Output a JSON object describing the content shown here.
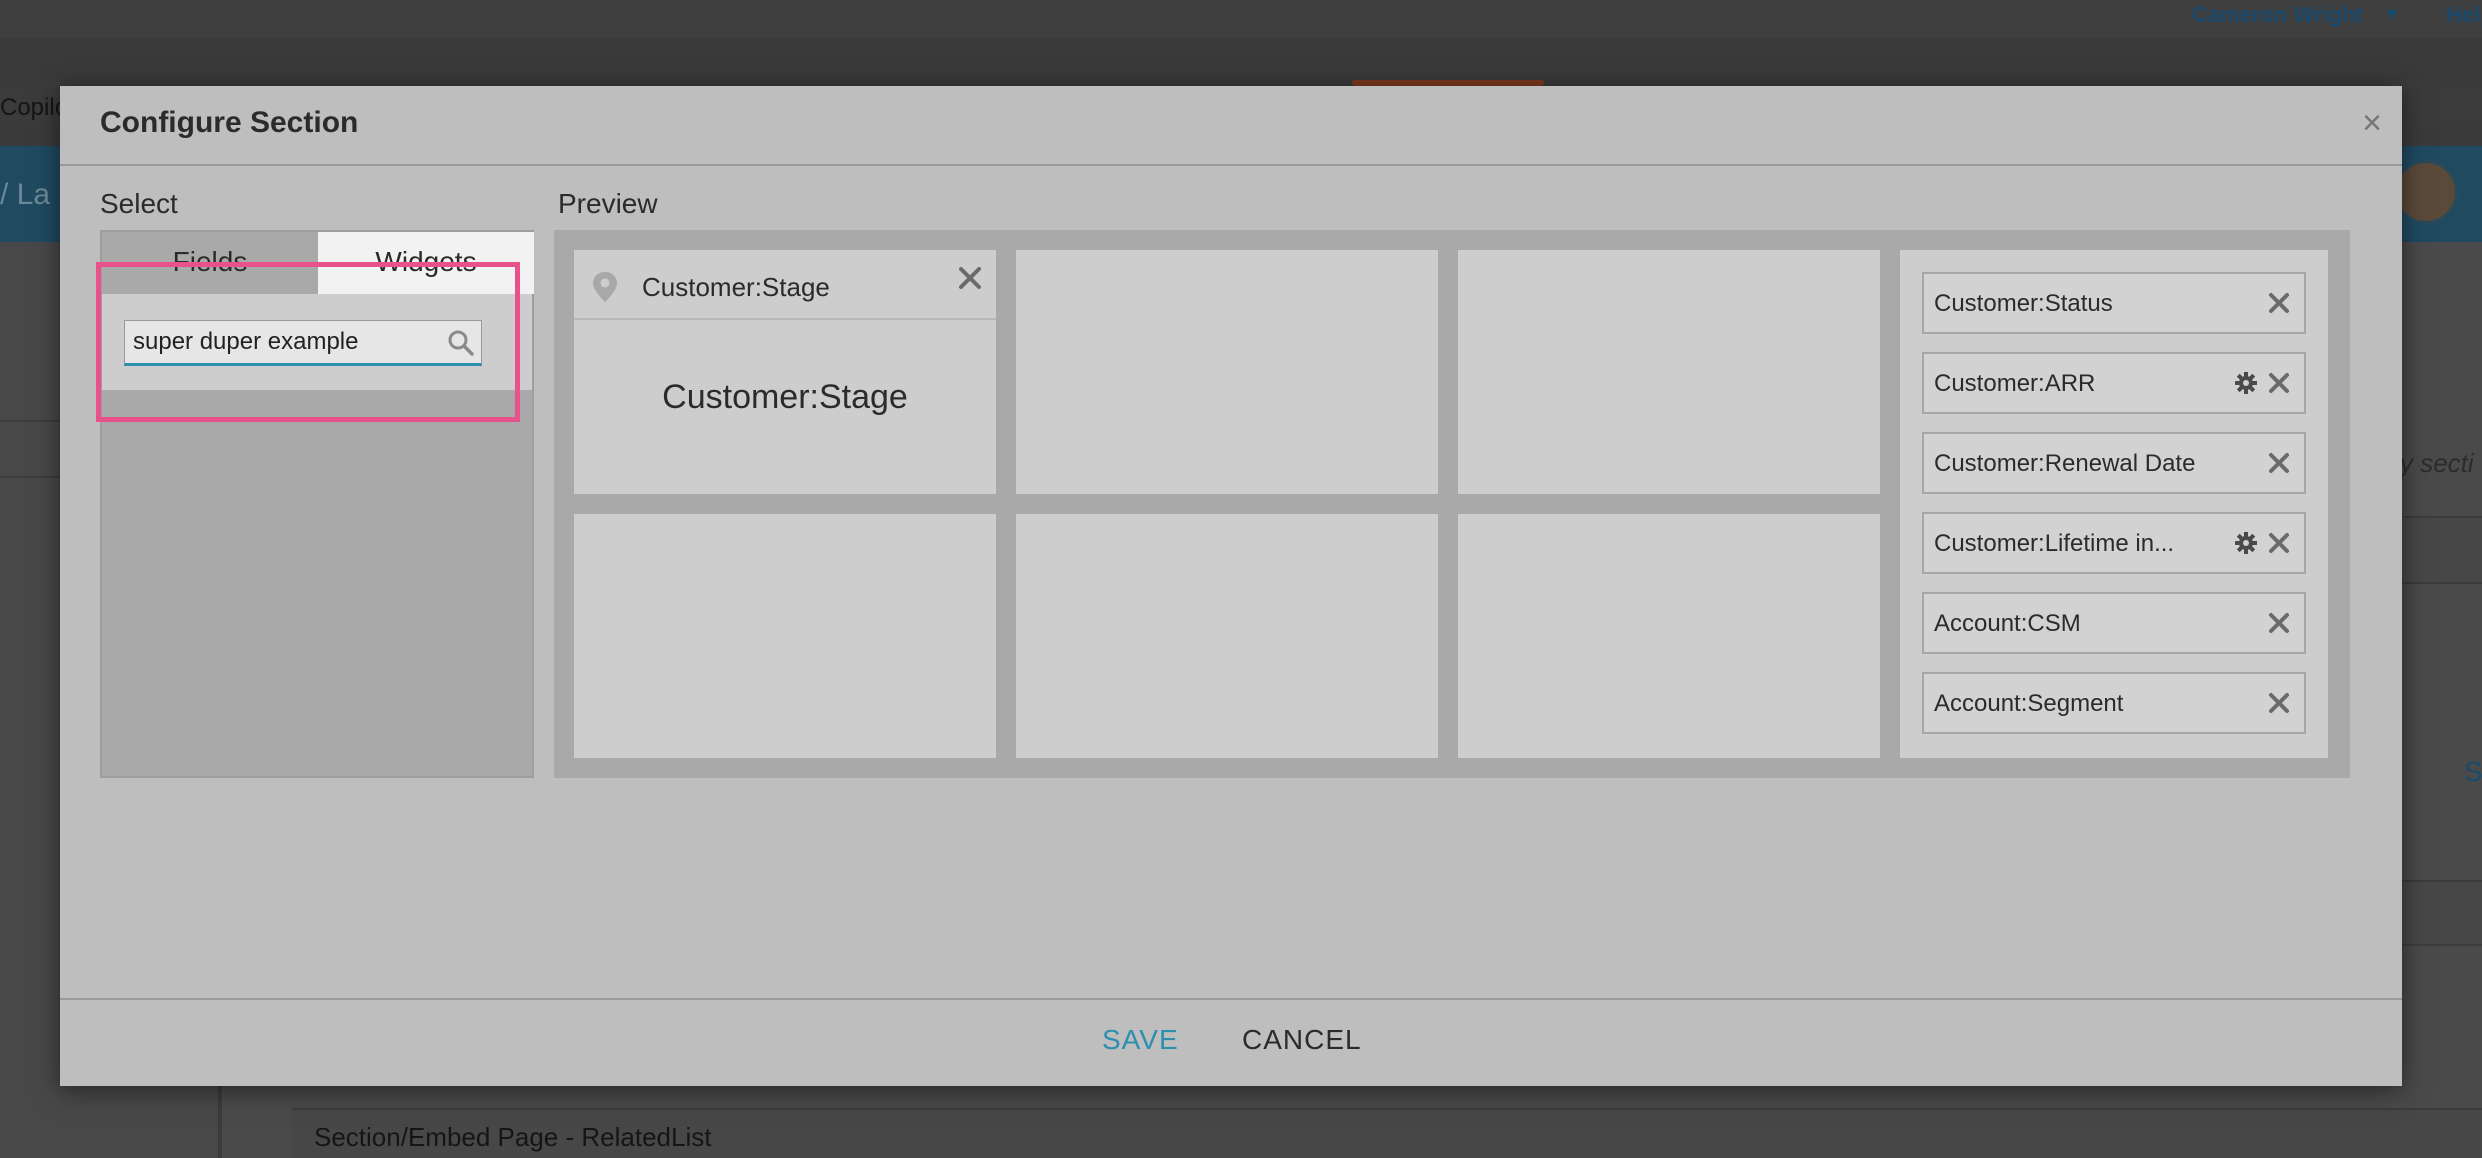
{
  "background": {
    "user_name": "Cameron Wright",
    "help_text": "Help",
    "nav_text": "Copilot",
    "breadcrumb": "/ La",
    "side_text": "y secti",
    "side_link": "S",
    "related_list": "Section/Embed Page - RelatedList"
  },
  "modal": {
    "title": "Configure Section",
    "close_glyph": "×",
    "select_label": "Select",
    "preview_label": "Preview",
    "tabs": {
      "fields": "Fields",
      "widgets": "Widgets"
    },
    "search": {
      "value": "super duper example",
      "placeholder": ""
    },
    "preview": {
      "placed_cell": {
        "header_label": "Customer:Stage",
        "body_label": "Customer:Stage"
      },
      "field_list": [
        {
          "label": "Customer:Status",
          "has_settings": false
        },
        {
          "label": "Customer:ARR",
          "has_settings": true
        },
        {
          "label": "Customer:Renewal Date",
          "has_settings": false
        },
        {
          "label": "Customer:Lifetime in...",
          "has_settings": true
        },
        {
          "label": "Account:CSM",
          "has_settings": false
        },
        {
          "label": "Account:Segment",
          "has_settings": false
        }
      ]
    },
    "footer": {
      "save_label": "SAVE",
      "cancel_label": "CANCEL"
    }
  },
  "colors": {
    "accent": "#2c8fb0",
    "highlight": "#e8528a"
  }
}
